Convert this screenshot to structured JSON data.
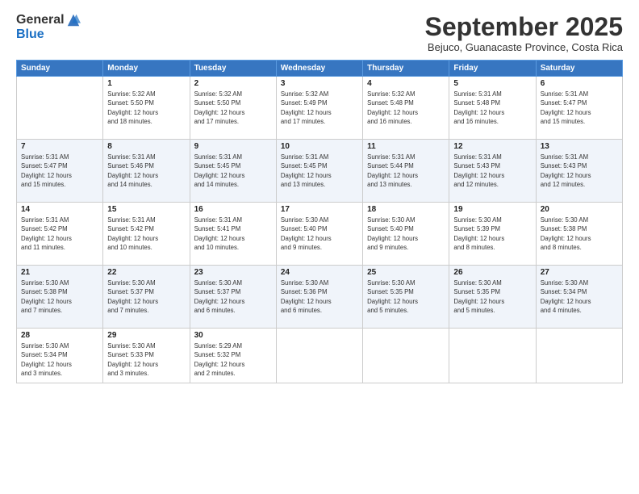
{
  "logo": {
    "general": "General",
    "blue": "Blue"
  },
  "header": {
    "month": "September 2025",
    "location": "Bejuco, Guanacaste Province, Costa Rica"
  },
  "weekdays": [
    "Sunday",
    "Monday",
    "Tuesday",
    "Wednesday",
    "Thursday",
    "Friday",
    "Saturday"
  ],
  "weeks": [
    [
      {
        "day": "",
        "info": ""
      },
      {
        "day": "1",
        "info": "Sunrise: 5:32 AM\nSunset: 5:50 PM\nDaylight: 12 hours\nand 18 minutes."
      },
      {
        "day": "2",
        "info": "Sunrise: 5:32 AM\nSunset: 5:50 PM\nDaylight: 12 hours\nand 17 minutes."
      },
      {
        "day": "3",
        "info": "Sunrise: 5:32 AM\nSunset: 5:49 PM\nDaylight: 12 hours\nand 17 minutes."
      },
      {
        "day": "4",
        "info": "Sunrise: 5:32 AM\nSunset: 5:48 PM\nDaylight: 12 hours\nand 16 minutes."
      },
      {
        "day": "5",
        "info": "Sunrise: 5:31 AM\nSunset: 5:48 PM\nDaylight: 12 hours\nand 16 minutes."
      },
      {
        "day": "6",
        "info": "Sunrise: 5:31 AM\nSunset: 5:47 PM\nDaylight: 12 hours\nand 15 minutes."
      }
    ],
    [
      {
        "day": "7",
        "info": "Sunrise: 5:31 AM\nSunset: 5:47 PM\nDaylight: 12 hours\nand 15 minutes."
      },
      {
        "day": "8",
        "info": "Sunrise: 5:31 AM\nSunset: 5:46 PM\nDaylight: 12 hours\nand 14 minutes."
      },
      {
        "day": "9",
        "info": "Sunrise: 5:31 AM\nSunset: 5:45 PM\nDaylight: 12 hours\nand 14 minutes."
      },
      {
        "day": "10",
        "info": "Sunrise: 5:31 AM\nSunset: 5:45 PM\nDaylight: 12 hours\nand 13 minutes."
      },
      {
        "day": "11",
        "info": "Sunrise: 5:31 AM\nSunset: 5:44 PM\nDaylight: 12 hours\nand 13 minutes."
      },
      {
        "day": "12",
        "info": "Sunrise: 5:31 AM\nSunset: 5:43 PM\nDaylight: 12 hours\nand 12 minutes."
      },
      {
        "day": "13",
        "info": "Sunrise: 5:31 AM\nSunset: 5:43 PM\nDaylight: 12 hours\nand 12 minutes."
      }
    ],
    [
      {
        "day": "14",
        "info": "Sunrise: 5:31 AM\nSunset: 5:42 PM\nDaylight: 12 hours\nand 11 minutes."
      },
      {
        "day": "15",
        "info": "Sunrise: 5:31 AM\nSunset: 5:42 PM\nDaylight: 12 hours\nand 10 minutes."
      },
      {
        "day": "16",
        "info": "Sunrise: 5:31 AM\nSunset: 5:41 PM\nDaylight: 12 hours\nand 10 minutes."
      },
      {
        "day": "17",
        "info": "Sunrise: 5:30 AM\nSunset: 5:40 PM\nDaylight: 12 hours\nand 9 minutes."
      },
      {
        "day": "18",
        "info": "Sunrise: 5:30 AM\nSunset: 5:40 PM\nDaylight: 12 hours\nand 9 minutes."
      },
      {
        "day": "19",
        "info": "Sunrise: 5:30 AM\nSunset: 5:39 PM\nDaylight: 12 hours\nand 8 minutes."
      },
      {
        "day": "20",
        "info": "Sunrise: 5:30 AM\nSunset: 5:38 PM\nDaylight: 12 hours\nand 8 minutes."
      }
    ],
    [
      {
        "day": "21",
        "info": "Sunrise: 5:30 AM\nSunset: 5:38 PM\nDaylight: 12 hours\nand 7 minutes."
      },
      {
        "day": "22",
        "info": "Sunrise: 5:30 AM\nSunset: 5:37 PM\nDaylight: 12 hours\nand 7 minutes."
      },
      {
        "day": "23",
        "info": "Sunrise: 5:30 AM\nSunset: 5:37 PM\nDaylight: 12 hours\nand 6 minutes."
      },
      {
        "day": "24",
        "info": "Sunrise: 5:30 AM\nSunset: 5:36 PM\nDaylight: 12 hours\nand 6 minutes."
      },
      {
        "day": "25",
        "info": "Sunrise: 5:30 AM\nSunset: 5:35 PM\nDaylight: 12 hours\nand 5 minutes."
      },
      {
        "day": "26",
        "info": "Sunrise: 5:30 AM\nSunset: 5:35 PM\nDaylight: 12 hours\nand 5 minutes."
      },
      {
        "day": "27",
        "info": "Sunrise: 5:30 AM\nSunset: 5:34 PM\nDaylight: 12 hours\nand 4 minutes."
      }
    ],
    [
      {
        "day": "28",
        "info": "Sunrise: 5:30 AM\nSunset: 5:34 PM\nDaylight: 12 hours\nand 3 minutes."
      },
      {
        "day": "29",
        "info": "Sunrise: 5:30 AM\nSunset: 5:33 PM\nDaylight: 12 hours\nand 3 minutes."
      },
      {
        "day": "30",
        "info": "Sunrise: 5:29 AM\nSunset: 5:32 PM\nDaylight: 12 hours\nand 2 minutes."
      },
      {
        "day": "",
        "info": ""
      },
      {
        "day": "",
        "info": ""
      },
      {
        "day": "",
        "info": ""
      },
      {
        "day": "",
        "info": ""
      }
    ]
  ]
}
